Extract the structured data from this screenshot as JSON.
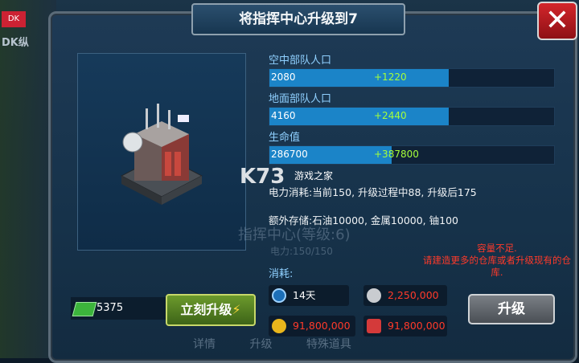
{
  "background": {
    "tag": "DK纵",
    "badge": "DK"
  },
  "dialog": {
    "title": "将指挥中心升级到7",
    "close_label": "✕"
  },
  "stats": [
    {
      "label": "空中部队人口",
      "current": "2080",
      "increase": "+1220",
      "fill_fraction": 0.63
    },
    {
      "label": "地面部队人口",
      "current": "4160",
      "increase": "+2440",
      "fill_fraction": 0.63
    },
    {
      "label": "生命值",
      "current": "286700",
      "increase": "+387800",
      "fill_fraction": 0.43
    }
  ],
  "power_info": "电力消耗:当前150, 升级过程中88, 升级后175",
  "extra_storage": "额外存储:石油10000, 金属10000, 铀100",
  "watermark": {
    "main": "K73",
    "sub": "游戏之家"
  },
  "ghost_text": {
    "name": "指挥中心(等级:6)",
    "power": "电力:150/150"
  },
  "warning": {
    "line1": "容量不足.",
    "line2": "请建造更多的仓库或者升级现有的仓库."
  },
  "cost_label": "消耗:",
  "costs": {
    "time": "14天",
    "metal": "2,250,000",
    "gold": "91,800,000",
    "oil": "91,800,000"
  },
  "money": "5375",
  "instant_upgrade_label": "立刻升级",
  "upgrade_label": "升级",
  "bottom_tabs": [
    "详情",
    "升级",
    "特殊道具"
  ],
  "colors": {
    "stat_label": "#8fd0ff",
    "increase": "#a6ff3a",
    "warning": "#ff3a2a",
    "cost_red": "#ff3a2a"
  }
}
